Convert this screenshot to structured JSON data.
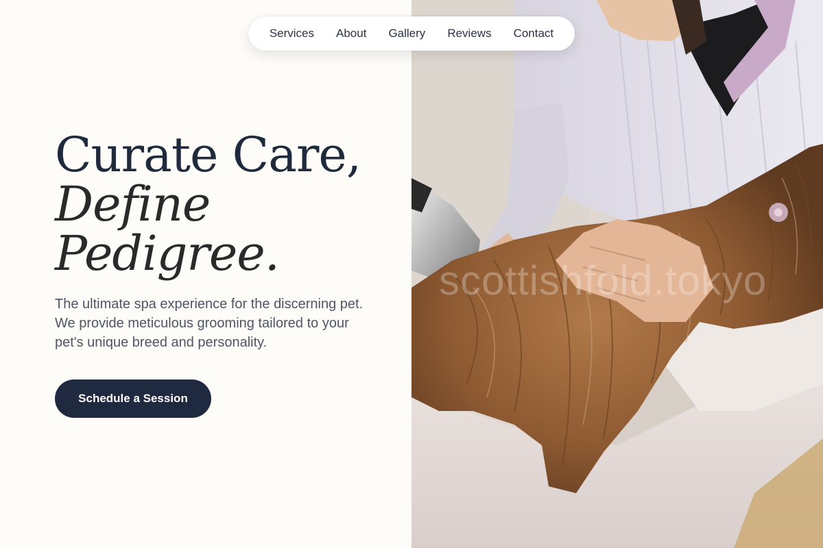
{
  "nav": {
    "items": [
      {
        "label": "Services"
      },
      {
        "label": "About"
      },
      {
        "label": "Gallery"
      },
      {
        "label": "Reviews"
      },
      {
        "label": "Contact"
      }
    ]
  },
  "hero": {
    "headline_line1": "Curate Care,",
    "headline_line2": "Define",
    "headline_line3": "Pedigree.",
    "description": "The ultimate spa experience for the discerning pet. We provide meticulous grooming tailored to your pet's unique breed and personality.",
    "cta_label": "Schedule a Session"
  },
  "photo": {
    "subject": "groomer drying a long-haired dog with a hair dryer",
    "watermark": "scottishfold.tokyo"
  },
  "colors": {
    "background": "#fdfcf9",
    "heading": "#1f2a3c",
    "body_text": "#4e5564",
    "cta_background": "#1f2a40",
    "cta_text": "#ffffff"
  }
}
